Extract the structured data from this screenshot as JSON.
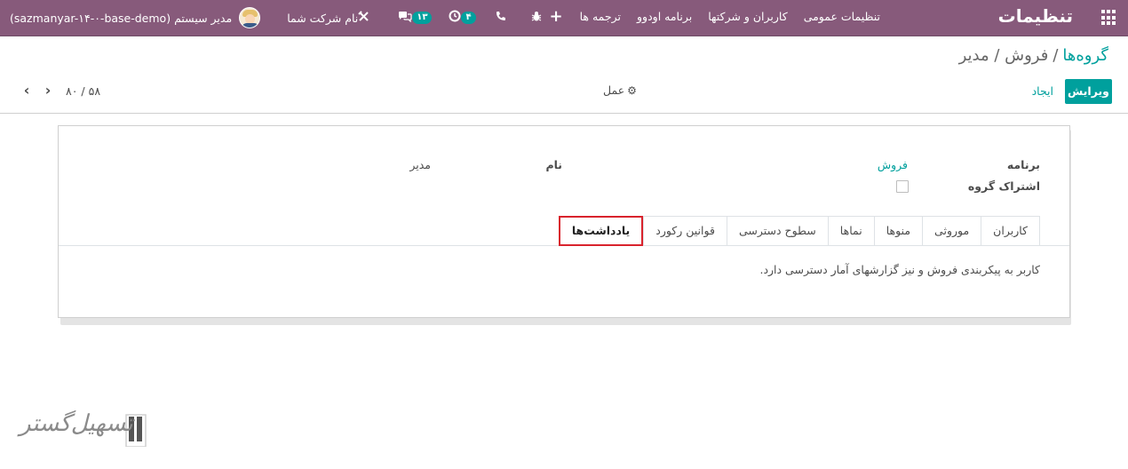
{
  "navbar": {
    "app_title": "تنظیمات",
    "menu_items": [
      "تنظیمات عمومی",
      "کاربران و شرکتها",
      "برنامه اودوو",
      "ترجمه ها"
    ],
    "plus_label": "+",
    "bg_color": "#875a7b",
    "systray": {
      "user_db": "(sazmanyar-۱۴-۰-base-demo)",
      "user_name": "مدیر سیستم",
      "company_name": "نام شرکت شما",
      "chat_count": "۱۳",
      "activity_count": "۴"
    },
    "icons": {
      "apps": "apps-grid-icon",
      "company": "company-switch-icon",
      "chat": "chat-icon",
      "activity": "clock-icon",
      "phone": "phone-icon",
      "debug": "bug-icon"
    }
  },
  "control_panel": {
    "breadcrumb": {
      "root": "گروه‌ها",
      "separator": "/",
      "current": "فروش / مدیر"
    },
    "buttons": {
      "edit": "ویرایش",
      "create": "ایجاد"
    },
    "action_label": "عمل",
    "pager": {
      "value": "۵۸ / ۸۰"
    }
  },
  "form": {
    "application_label": "برنامه",
    "application_value": "فروش",
    "share_group_label": "اشتراک گروه",
    "share_group_checked": false,
    "name_label": "نام",
    "name_value": "مدیر",
    "tabs": [
      {
        "label": "کاربران",
        "active": false
      },
      {
        "label": "موروثی",
        "active": false
      },
      {
        "label": "منوها",
        "active": false
      },
      {
        "label": "نماها",
        "active": false
      },
      {
        "label": "سطوح دسترسی",
        "active": false
      },
      {
        "label": "قوانین رکورد",
        "active": false
      },
      {
        "label": "یادداشت‌ها",
        "active": true
      }
    ],
    "note_text": "کاربر به پیکربندی فروش و نیز گزارشهای آمار دسترسی دارد."
  },
  "watermark": {
    "text": "تسهیل‌گستر"
  },
  "colors": {
    "accent": "#00a09d",
    "highlight_border": "#d9232d"
  }
}
